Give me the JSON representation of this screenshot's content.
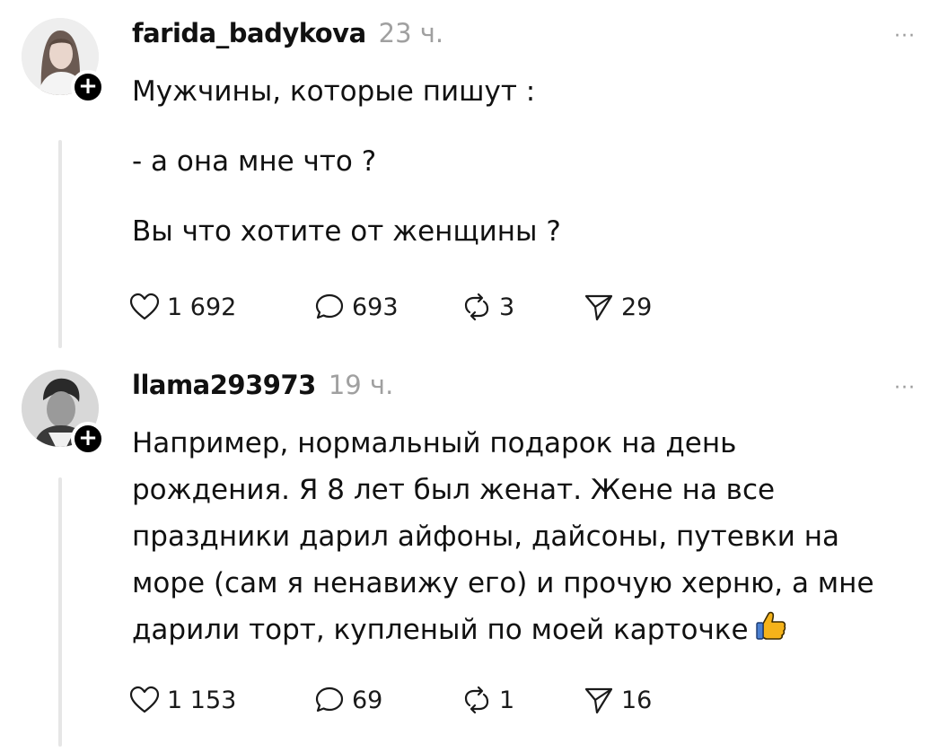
{
  "posts": [
    {
      "username": "farida_badykova",
      "time": "23 ч.",
      "more": "···",
      "paragraphs": [
        "Мужчины, которые пишут :",
        "- а она мне что ?",
        "Вы что хотите от женщины ?"
      ],
      "likes": "1 692",
      "replies": "693",
      "reposts": "3",
      "shares": "29"
    },
    {
      "username": "llama293973",
      "time": "19 ч.",
      "more": "···",
      "text": "Например, нормальный подарок на день\nрождения. Я 8 лет был женат. Жене на все\nпраздники дарил айфоны, дайсоны, путевки на\nморе (сам я ненавижу его) и прочую херню, а мне\nдарили торт, купленый по моей карточке",
      "emoji": "thumbs-up",
      "likes": "1 153",
      "replies": "69",
      "reposts": "1",
      "shares": "16"
    }
  ],
  "follow_symbol": "+",
  "colors": {
    "text": "#111111",
    "muted": "#a0a0a0",
    "thread_line": "#e6e6e6",
    "thumbs_up": "#f5b31a"
  },
  "icons": [
    "heart-icon",
    "comment-icon",
    "repost-icon",
    "share-icon",
    "more-icon",
    "plus-icon",
    "thumbs-up-emoji"
  ]
}
